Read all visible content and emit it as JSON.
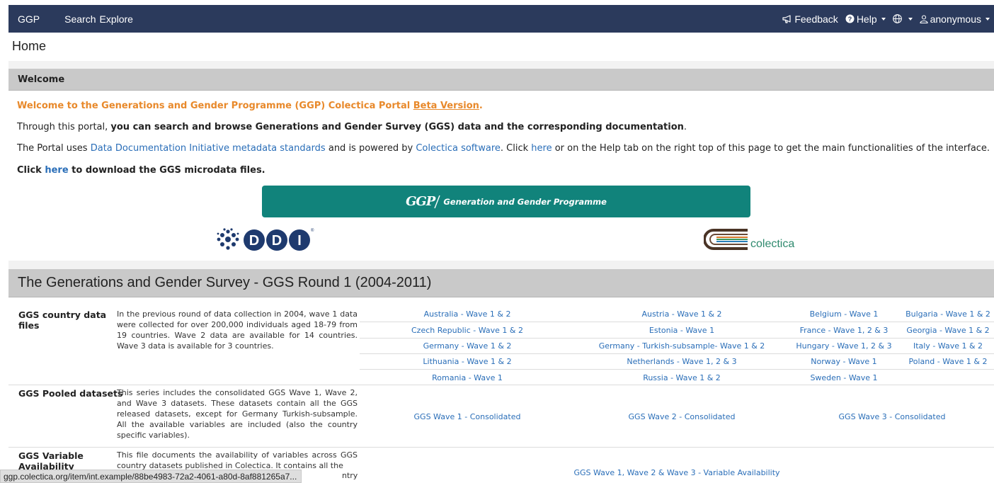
{
  "navbar": {
    "brand": "GGP",
    "links": [
      "Search",
      "Explore"
    ],
    "feedback": "Feedback",
    "help": "Help",
    "user": "anonymous"
  },
  "page_title": "Home",
  "welcome": {
    "header": "Welcome",
    "headline_a": "Welcome to the Generations and Gender Programme (GGP) Colectica Portal ",
    "headline_link": "Beta Version",
    "headline_b": ".",
    "line2_a": "Through this portal, ",
    "line2_bold": "you can search and browse Generations and Gender Survey (GGS) data and the corresponding documentation",
    "line2_b": ".",
    "line3_a": "The Portal uses ",
    "line3_link1": "Data Documentation Initiative metadata standards",
    "line3_b": " and is powered by ",
    "line3_link2": "Colectica software",
    "line3_c": ". Click ",
    "line3_link3": "here",
    "line3_d": " or on the Help tab on the right top of this page to get the main functionalities of the interface.",
    "line4_a": "Click ",
    "line4_link": "here",
    "line4_b": " to download the GGS microdata files."
  },
  "banner": {
    "logo_text": "GGP",
    "title": "Generation and Gender Programme"
  },
  "partner_logos": {
    "ddi": "DDI",
    "colectica": "colectica"
  },
  "ggs_section": {
    "title": "The Generations and Gender Survey - GGS Round 1 (2004-2011)",
    "rows": [
      {
        "title": "GGS country data files",
        "desc": "In the previous round of data collection in 2004, wave 1 data were collected for over 200,000 individuals aged 18-79 from 19 countries. Wave 2 data are available for 14 countries. Wave 3 data is available for 3 countries."
      },
      {
        "title": "GGS Pooled datasets",
        "desc": "This series includes the consolidated GGS Wave 1, Wave 2, and Wave 3 datasets. These datasets contain all the GGS released datasets, except for Germany Turkish-subsample. All the available variables are included (also the country specific variables)."
      },
      {
        "title": "GGS Variable Availability",
        "desc": "This file documents the availability of variables across GGS country datasets published in Colectica. It contains all the"
      }
    ],
    "country_links": [
      [
        "Australia - Wave 1 & 2",
        "Austria - Wave 1 & 2",
        "Belgium - Wave 1",
        "Bulgaria - Wave 1 & 2"
      ],
      [
        "Czech Republic - Wave 1 & 2",
        "Estonia - Wave 1",
        "France - Wave 1, 2 & 3",
        "Georgia - Wave 1 & 2"
      ],
      [
        "Germany - Wave 1 & 2",
        "Germany - Turkish-subsample- Wave 1 & 2",
        "Hungary - Wave 1, 2 & 3",
        "Italy - Wave 1 & 2"
      ],
      [
        "Lithuania - Wave 1 & 2",
        "Netherlands - Wave 1, 2 & 3",
        "Norway - Wave 1",
        "Poland - Wave 1 & 2"
      ],
      [
        "Romania - Wave 1",
        "Russia - Wave 1 & 2",
        "Sweden - Wave 1",
        ""
      ]
    ],
    "pooled_links": [
      "GGS Wave 1 - Consolidated",
      "GGS Wave 2 - Consolidated",
      "GGS Wave 3 - Consolidated"
    ],
    "availability_link": "GGS Wave 1, Wave 2 & Wave 3 - Variable Availability"
  },
  "status_bar": {
    "url": "ggp.colectica.org/item/int.example/88be4983-72a2-4061-a80d-8af881265a7...",
    "overlap_text": "ntry"
  }
}
